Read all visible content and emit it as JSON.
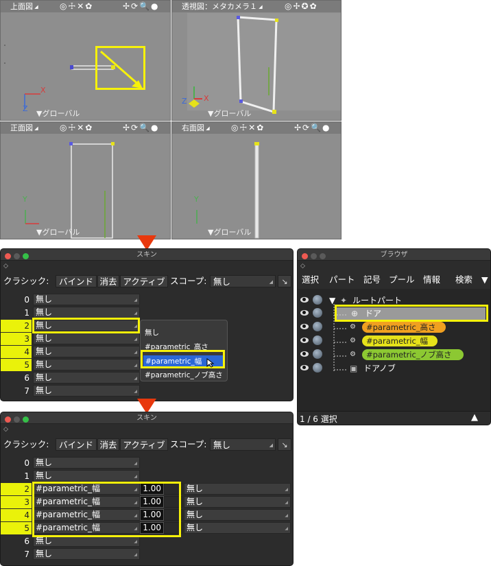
{
  "viewports": {
    "top": {
      "title": "上面図",
      "global": "▼グローバル",
      "tools": "◎☩✕✿",
      "tools2": "✢⟳🔍●",
      "axis_x": "X",
      "axis_z": "Z"
    },
    "persp": {
      "title": "透視図：メタカメラ１",
      "global": "▼グローバル",
      "tools": "◎✢✪✿",
      "axis_x": "X",
      "axis_z": "Z"
    },
    "front": {
      "title": "正面図",
      "global": "▼グローバル",
      "tools": "◎☩✕✿",
      "tools2": "✢⟳🔍●",
      "axis_x": "X",
      "axis_y": "Y"
    },
    "right": {
      "title": "右面図",
      "global": "▼グローバル",
      "tools": "◎☩✕✿",
      "tools2": "✢⟳🔍●",
      "axis_y": "Y"
    }
  },
  "skin1": {
    "title": "スキン",
    "sub": "◇",
    "classic_label": "クラシック:",
    "bind": "バインド",
    "clear": "消去",
    "active": "アクティブ",
    "scope_label": "スコープ:",
    "scope_value": "無し",
    "rows": [
      {
        "idx": "0",
        "val": "無し"
      },
      {
        "idx": "1",
        "val": "無し"
      },
      {
        "idx": "2",
        "val": "無し"
      },
      {
        "idx": "3",
        "val": "無し"
      },
      {
        "idx": "4",
        "val": "無し"
      },
      {
        "idx": "5",
        "val": "無し"
      },
      {
        "idx": "6",
        "val": "無し"
      },
      {
        "idx": "7",
        "val": "無し"
      }
    ],
    "popup": [
      "無し",
      "#parametric_高さ",
      "#parametric_幅",
      "#parametric_ノブ高さ"
    ]
  },
  "skin2": {
    "title": "スキン",
    "sub": "◇",
    "classic_label": "クラシック:",
    "bind": "バインド",
    "clear": "消去",
    "active": "アクティブ",
    "scope_label": "スコープ:",
    "scope_value": "無し",
    "rows": [
      {
        "idx": "0",
        "val": "無し"
      },
      {
        "idx": "1",
        "val": "無し"
      },
      {
        "idx": "2",
        "val": "#parametric_幅",
        "num": "1.00",
        "val2": "無し"
      },
      {
        "idx": "3",
        "val": "#parametric_幅",
        "num": "1.00",
        "val2": "無し"
      },
      {
        "idx": "4",
        "val": "#parametric_幅",
        "num": "1.00",
        "val2": "無し"
      },
      {
        "idx": "5",
        "val": "#parametric_幅",
        "num": "1.00",
        "val2": "無し"
      },
      {
        "idx": "6",
        "val": "無し"
      },
      {
        "idx": "7",
        "val": "無し"
      }
    ]
  },
  "browser": {
    "title": "ブラウザ",
    "sub": "◇",
    "tabs": [
      "選択",
      "パート",
      "記号",
      "プール",
      "情報",
      "検索"
    ],
    "tabs_more": "▼",
    "root": "ルートパート",
    "root_toggle": "▼",
    "door": "ドア",
    "params": [
      "#parametric_高さ",
      "#parametric_幅",
      "#parametric_ノブ高さ"
    ],
    "knob": "ドアノブ",
    "status": "1 / 6 選択",
    "status_btn": "▲"
  },
  "colors": {
    "highlight": "#f7f20a",
    "param_orange": "#f0a020",
    "param_yellow": "#e6e21a",
    "param_green": "#8cc832",
    "arrow": "#e8380d"
  }
}
